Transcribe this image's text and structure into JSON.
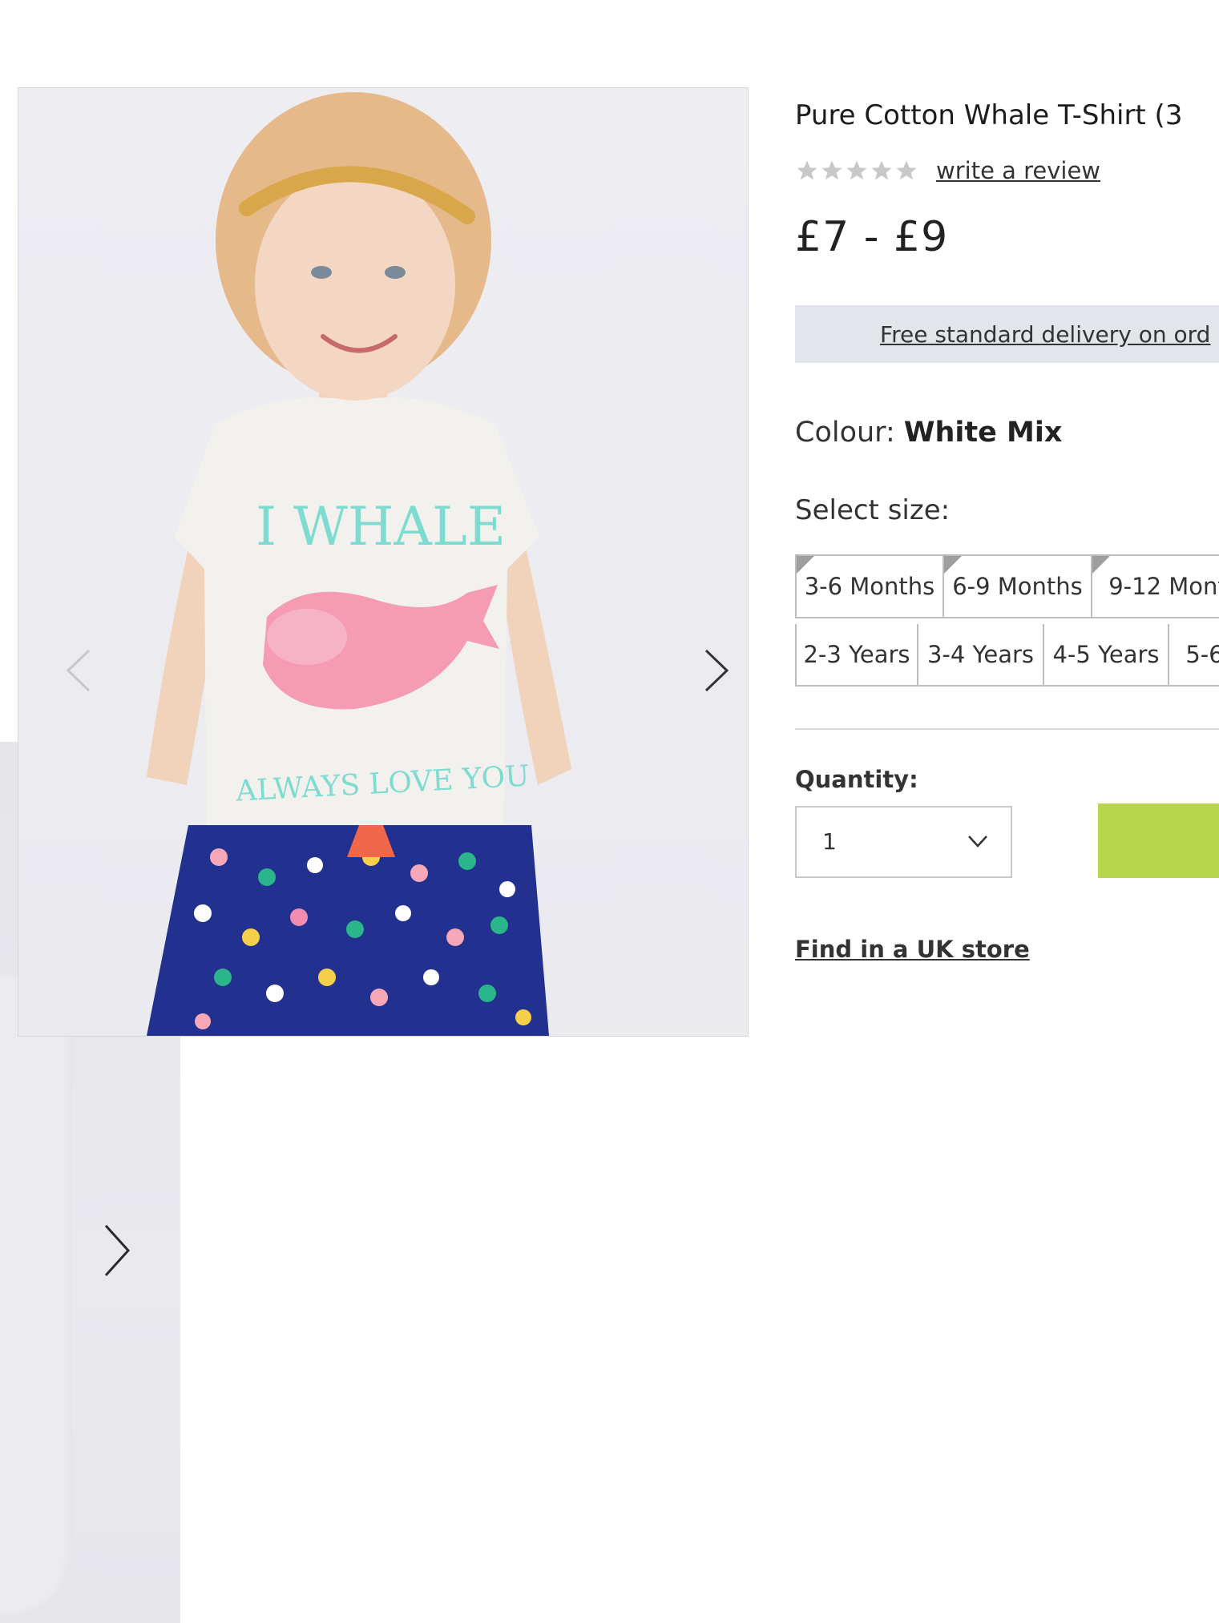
{
  "product": {
    "title": "Pure Cotton Whale T-Shirt (3",
    "review_link": "write a review",
    "price": "£7 - £9",
    "delivery_banner": "Free standard delivery on ord",
    "colour_label": "Colour: ",
    "colour_value": "White Mix",
    "size_label": "Select size:",
    "sizes_row1": [
      "3-6 Months",
      "6-9 Months",
      "9-12 Mont"
    ],
    "sizes_row2": [
      "2-3 Years",
      "3-4 Years",
      "4-5 Years",
      "5-6"
    ],
    "quantity_label": "Quantity:",
    "quantity_value": "1",
    "find_store": "Find in a UK store"
  },
  "image": {
    "shirt_text_top": "I WHALE",
    "shirt_text_bottom": "ALWAYS LOVE YOU"
  },
  "icons": {
    "rating": "star-icon",
    "prev": "chevron-left-icon",
    "next": "chevron-right-icon",
    "dropdown": "chevron-down-icon"
  },
  "colors": {
    "add_button": "#bad54e",
    "delivery_banner": "#e2e6ea",
    "star": "#c8c8c8"
  }
}
